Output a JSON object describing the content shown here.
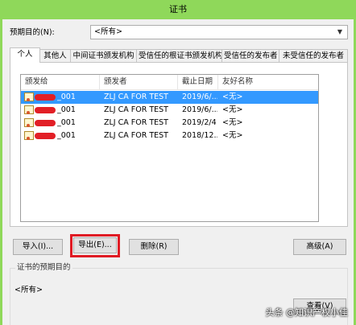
{
  "window": {
    "title": "证书"
  },
  "purpose": {
    "label": "预期目的(N):",
    "selected": "<所有>"
  },
  "tabs": [
    {
      "label": "个人",
      "active": true
    },
    {
      "label": "其他人"
    },
    {
      "label": "中间证书颁发机构"
    },
    {
      "label": "受信任的根证书颁发机构"
    },
    {
      "label": "受信任的发布者"
    },
    {
      "label": "未受信任的发布者"
    }
  ],
  "list": {
    "columns": [
      "颁发给",
      "颁发者",
      "截止日期",
      "友好名称"
    ],
    "rows": [
      {
        "issued_to": "_001",
        "issuer": "ZLJ CA FOR TEST",
        "expires": "2019/6/...",
        "friendly": "<无>",
        "selected": true
      },
      {
        "issued_to": "_001",
        "issuer": "ZLJ CA FOR TEST",
        "expires": "2019/6/...",
        "friendly": "<无>"
      },
      {
        "issued_to": "_001",
        "issuer": "ZLJ CA FOR TEST",
        "expires": "2019/2/4",
        "friendly": "<无>"
      },
      {
        "issued_to": "_001",
        "issuer": "ZLJ CA FOR TEST",
        "expires": "2018/12...",
        "friendly": "<无>"
      }
    ]
  },
  "buttons": {
    "import": "导入(I)...",
    "export": "导出(E)...",
    "remove": "删除(R)",
    "advanced": "高级(A)",
    "view": "查看(V)"
  },
  "purposes_group": {
    "label": "证书的预期目的",
    "value": "<所有>"
  },
  "watermark": "头条 @知识产权小佳",
  "colors": {
    "selection": "#3399ff",
    "highlight": "#e01b24",
    "frame": "#8fd85a"
  }
}
